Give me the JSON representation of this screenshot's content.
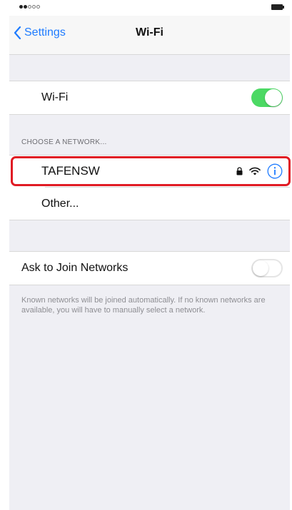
{
  "navbar": {
    "back_label": "Settings",
    "title": "Wi-Fi"
  },
  "wifi_toggle": {
    "label": "Wi-Fi",
    "state": "on"
  },
  "networks": {
    "section_header": "CHOOSE A NETWORK...",
    "items": [
      {
        "name": "TAFENSW",
        "icons": [
          "lock-icon",
          "wifi-signal-icon",
          "info-icon"
        ],
        "highlighted": true
      },
      {
        "name": "Other...",
        "icons": [],
        "highlighted": false
      }
    ]
  },
  "ask_to_join": {
    "label": "Ask to Join Networks",
    "state": "off",
    "footer": "Known networks will be joined automatically. If no known networks are available, you will have to manually select a network."
  },
  "colors": {
    "accent": "#1e7bff",
    "toggle_on": "#4cd964",
    "highlight": "#e01b24",
    "background": "#efeff4"
  }
}
